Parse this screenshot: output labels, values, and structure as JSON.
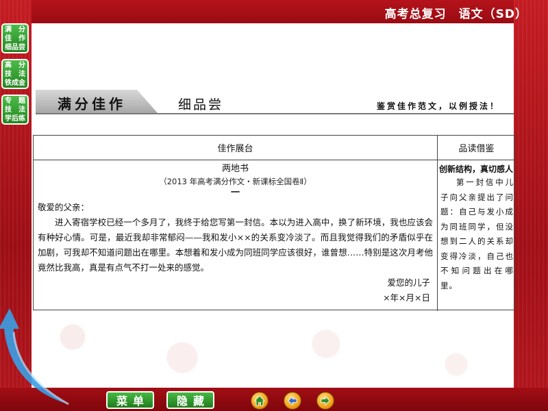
{
  "header": {
    "title": "高考总复习　语文（SD）"
  },
  "nav": {
    "items": [
      {
        "lines": [
          "满　分",
          "佳　作",
          "细品尝"
        ]
      },
      {
        "lines": [
          "高　分",
          "技　法",
          "铁成金"
        ]
      },
      {
        "lines": [
          "专　题",
          "技　法",
          "学后练"
        ]
      }
    ]
  },
  "banner": {
    "title": "满分佳作",
    "subtitle": "细品尝",
    "slogan": "鉴赏佳作范文，以例授法！"
  },
  "table": {
    "headers": [
      "佳作展台",
      "品读借鉴"
    ],
    "letter": {
      "title": "两地书",
      "source": "（2013 年高考满分作文・新课标全国卷Ⅱ）",
      "part": "一",
      "greeting": "敬爱的父亲：",
      "body": "进入寄宿学校已经一个多月了，我终于给您写第一封信。本以为进入高中，换了新环境，我也应该会有种好心情。可是，最近我却非常郁闷——我和发小××的关系变冷淡了。而且我觉得我们的矛盾似乎在加剧，可我却不知道问题出在哪里。本想着和发小成为同班同学应该很好，谁曾想……特别是这次月考他竟然比我高，真是有点气不打一处来的感觉。",
      "signature": "爱您的儿子",
      "date": "×年×月×日"
    },
    "comment": {
      "title": "创新结构，真切感人",
      "text": "第一封信中儿子向父亲提出了问题：自己与发小成为同班同学，但没想到二人的关系却变得冷淡，自己也不知问题出在哪里。"
    }
  },
  "controls": {
    "menu_label": "菜单",
    "hide_label": "隐藏"
  },
  "icons": [
    "home-icon",
    "back-icon",
    "next-icon"
  ],
  "colors": {
    "background": "#b8141c",
    "nav_green": "#2f9a2b",
    "paper": "#ffffff"
  }
}
